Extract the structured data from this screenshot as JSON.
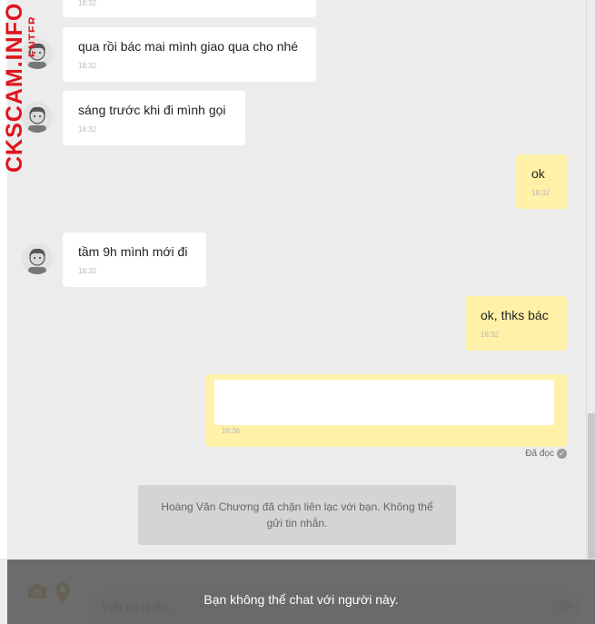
{
  "watermark": {
    "main": "CKSCAM.INFO",
    "sub": "ENTER"
  },
  "messages": [
    {
      "side": "in",
      "text": "",
      "time": "18:32"
    },
    {
      "side": "in",
      "text": "qua rồi bác mai mình giao qua cho nhé",
      "time": "18:32"
    },
    {
      "side": "in",
      "text": "sáng trước khi đi mình gọi",
      "time": "18:32"
    },
    {
      "side": "out",
      "text": "ok",
      "time": "18:32"
    },
    {
      "side": "in",
      "text": "tầm 9h mình mới đi",
      "time": "18:32"
    },
    {
      "side": "out",
      "text": "ok, thks bác",
      "time": "18:32"
    },
    {
      "side": "out",
      "text": "",
      "time": "18:36"
    }
  ],
  "read_status": "Đã đọc",
  "blocked_notice": "Hoàng Văn Chương đã chặn liên lạc với bạn. Không thể gửi tin nhắn.",
  "composer": {
    "placeholder": "Viết tin nhắn...",
    "disabled_text": "Bạn không thể chat với người này."
  },
  "colors": {
    "incoming_bubble": "#ffffff",
    "outgoing_bubble": "#fff1a8",
    "watermark": "#e0141c",
    "accent_icons": "#c78a3a"
  }
}
